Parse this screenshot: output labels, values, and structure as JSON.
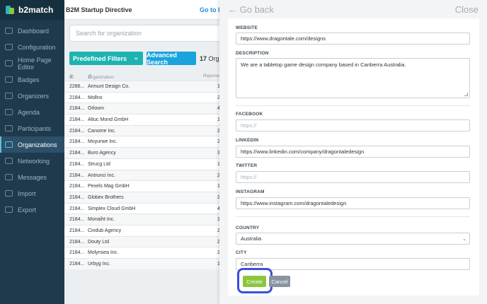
{
  "app": {
    "logo_text": "b2match",
    "event_title": "B2M Startup Directive",
    "goto_link": "Go to Ev"
  },
  "sidebar": {
    "items": [
      {
        "label": "Dashboard",
        "icon": "dashboard-icon"
      },
      {
        "label": "Configuration",
        "icon": "gear-icon"
      },
      {
        "label": "Home Page Editor",
        "icon": "document-icon"
      },
      {
        "label": "Badges",
        "icon": "badge-icon"
      },
      {
        "label": "Organizers",
        "icon": "users-icon"
      },
      {
        "label": "Agenda",
        "icon": "calendar-icon"
      },
      {
        "label": "Participants",
        "icon": "people-icon"
      },
      {
        "label": "Organizations",
        "icon": "building-icon",
        "active": true
      },
      {
        "label": "Networking",
        "icon": "network-icon"
      },
      {
        "label": "Messages",
        "icon": "envelope-icon"
      },
      {
        "label": "Import",
        "icon": "import-icon"
      },
      {
        "label": "Export",
        "icon": "export-icon"
      }
    ]
  },
  "main": {
    "search_placeholder": "Search for organization",
    "filters_label": "Predefined Filters",
    "advanced_search_label": "Advanced Search",
    "count_number": "17",
    "count_text": "Orga",
    "columns": {
      "id": "ID",
      "organization": "Organization",
      "rep": "Represe"
    },
    "rows": [
      {
        "id": "2286...",
        "org": "Armunt Design Co.",
        "rep": "1"
      },
      {
        "id": "2184...",
        "org": "Mollno",
        "rep": "2"
      },
      {
        "id": "2184...",
        "org": "Orloom",
        "rep": "4"
      },
      {
        "id": "2184...",
        "org": "Altuc Mond GmbH",
        "rep": "1"
      },
      {
        "id": "2184...",
        "org": "Canome Inc.",
        "rep": "2"
      },
      {
        "id": "2184...",
        "org": "Moyurwe Inc.",
        "rep": "2"
      },
      {
        "id": "2184...",
        "org": "Buro Agency",
        "rep": "3"
      },
      {
        "id": "2184...",
        "org": "Strucg Ltd",
        "rep": "1"
      },
      {
        "id": "2184...",
        "org": "Antrunci Inc.",
        "rep": "2"
      },
      {
        "id": "2184...",
        "org": "Pexels Mag GmbH",
        "rep": "1"
      },
      {
        "id": "2184...",
        "org": "Globex Brothers",
        "rep": "2"
      },
      {
        "id": "2184...",
        "org": "Simplex Cloud GmbH",
        "rep": "4"
      },
      {
        "id": "2184...",
        "org": "Monaiht Inc.",
        "rep": "1"
      },
      {
        "id": "2184...",
        "org": "Cindub Agency",
        "rep": "2"
      },
      {
        "id": "2184...",
        "org": "Douty Ltd",
        "rep": "2"
      },
      {
        "id": "2184...",
        "org": "Molynsea Inc.",
        "rep": "2"
      },
      {
        "id": "2184...",
        "org": "Urbyg Inc.",
        "rep": "1"
      }
    ]
  },
  "panel": {
    "go_back": "Go back",
    "close": "Close",
    "website_label": "WEBSITE",
    "website_value": "https://www.dragontale.com/designs",
    "description_label": "DESCRIPTION",
    "description_value": "We are a tabletop game design company based in Canberra Australia.",
    "facebook_label": "FACEBOOK",
    "facebook_placeholder": "https://",
    "linkedin_label": "LINKEDIN",
    "linkedin_value": "https://www.linkedin.com/company/dragontaledesign",
    "twitter_label": "TWITTER",
    "twitter_placeholder": "https://",
    "instagram_label": "INSTAGRAM",
    "instagram_value": "https://www.instagram.com/dragontaledesign",
    "country_label": "COUNTRY",
    "country_value": "Australia",
    "city_label": "CITY",
    "city_value": "Canberra",
    "create_label": "Create",
    "cancel_label": "Cancel"
  },
  "colors": {
    "sidebar_bg": "#1e3a4c",
    "accent_teal": "#1eb3b0",
    "accent_blue": "#1aa3dc",
    "create_green": "#8cc63f",
    "highlight_ring": "#3b4fe0"
  }
}
